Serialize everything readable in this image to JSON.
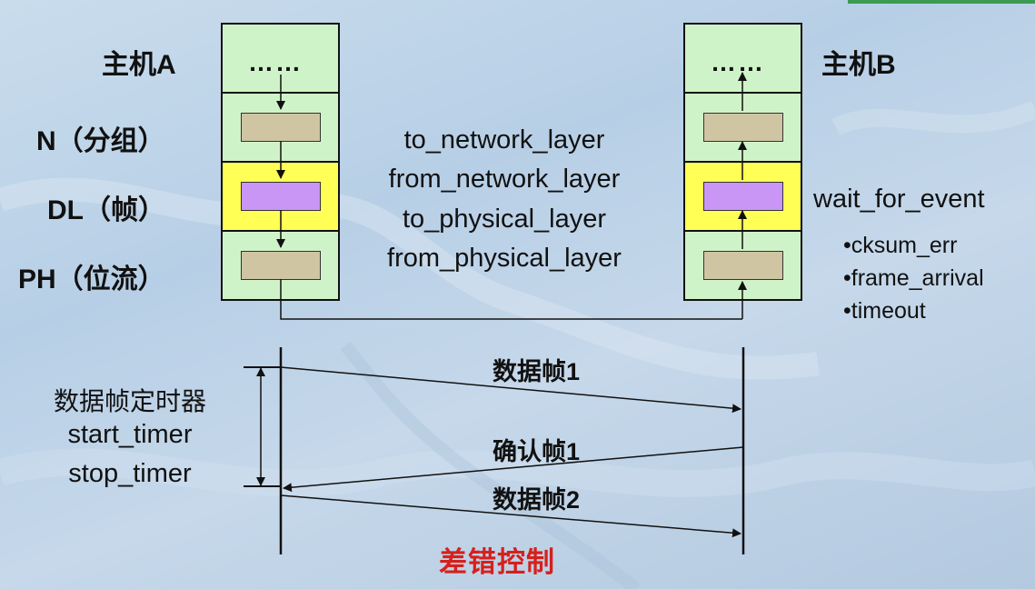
{
  "host_a": {
    "label": "主机A"
  },
  "host_b": {
    "label": "主机B"
  },
  "layers": {
    "network": "N（分组）",
    "datalink": "DL（帧）",
    "physical": "PH（位流）"
  },
  "upper_layer": {
    "dots": "……"
  },
  "functions": [
    "to_network_layer",
    "from_network_layer",
    "to_physical_layer",
    "from_physical_layer"
  ],
  "events": {
    "title": "wait_for_event",
    "items": [
      "•cksum_err",
      "•frame_arrival",
      "•timeout"
    ]
  },
  "timer": {
    "title": "数据帧定时器",
    "start": "start_timer",
    "stop": "stop_timer"
  },
  "frames": {
    "data1": "数据帧1",
    "ack1": "确认帧1",
    "data2": "数据帧2"
  },
  "caption": "差错控制",
  "colors": {
    "layer_green": "#cff3c8",
    "layer_yellow": "#ffff55",
    "box_khaki": "#cfc5a3",
    "box_purple": "#c996f5",
    "caption_red": "#d6201c"
  }
}
